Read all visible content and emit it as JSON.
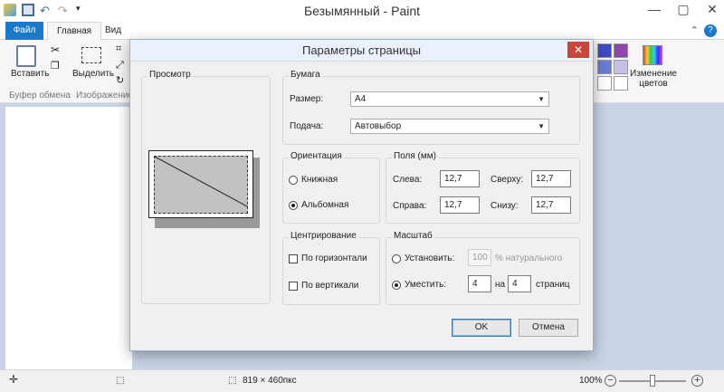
{
  "window": {
    "title": "Безымянный - Paint"
  },
  "ribbon": {
    "tabs": [
      "Файл",
      "Главная",
      "Вид"
    ],
    "paste_label": "Вставить",
    "select_label": "Выделить",
    "group_clipboard": "Буфер обмена",
    "group_image": "Изображение",
    "edit_colors_line1": "Изменение",
    "edit_colors_line2": "цветов",
    "palette_colors": [
      "#3f48cc",
      "#8e44ad",
      "#6b7ad3",
      "#c8bfe7",
      "#ffffff",
      "#ffffff"
    ]
  },
  "dialog": {
    "title": "Параметры страницы",
    "preview_label": "Просмотр",
    "paper": {
      "group_label": "Бумага",
      "size_label": "Размер:",
      "size_value": "A4",
      "source_label": "Подача:",
      "source_value": "Автовыбор"
    },
    "orientation": {
      "group_label": "Ориентация",
      "portrait": "Книжная",
      "landscape": "Альбомная",
      "selected": "landscape"
    },
    "margins": {
      "group_label": "Поля (мм)",
      "left_label": "Слева:",
      "left": "12,7",
      "top_label": "Сверху:",
      "top": "12,7",
      "right_label": "Справа:",
      "right": "12,7",
      "bottom_label": "Снизу:",
      "bottom": "12,7"
    },
    "centering": {
      "group_label": "Центрирование",
      "horizontal": "По горизонтали",
      "vertical": "По вертикали"
    },
    "scale": {
      "group_label": "Масштаб",
      "adjust_label": "Установить:",
      "adjust_value": "100",
      "adjust_suffix": "% натурального",
      "fit_label": "Уместить:",
      "fit_w": "4",
      "fit_mid": "на",
      "fit_h": "4",
      "fit_suffix": "страниц",
      "selected": "fit"
    },
    "ok_label": "OK",
    "cancel_label": "Отмена"
  },
  "statusbar": {
    "image_size": "819 × 460пкс",
    "zoom": "100%"
  }
}
